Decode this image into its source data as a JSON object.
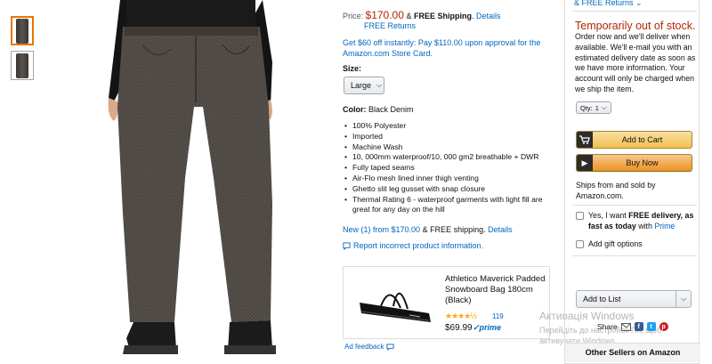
{
  "gallery": {
    "thumb_count": 2,
    "active_index": 0
  },
  "pricing": {
    "price_label": "Price:",
    "price": "$170.00",
    "amp": "&",
    "free_shipping": "FREE Shipping",
    "details": "Details",
    "free_returns": "FREE Returns"
  },
  "promo": "Get $60 off instantly: Pay $110.00 upon approval for the Amazon.com Store Card.",
  "size": {
    "label": "Size:",
    "value": "Large"
  },
  "color": {
    "label": "Color:",
    "value": "Black Denim"
  },
  "bullets": [
    "100% Polyester",
    "Imported",
    "Machine Wash",
    "10, 000mm waterproof/10, 000 gm2 breathable + DWR",
    "Fully taped seams",
    "Air-Flo mesh lined inner thigh venting",
    "Ghetto slit leg gusset with snap closure",
    "Thermal Rating 6 - waterproof garments with light fill are great for any day on the hill"
  ],
  "offers": {
    "new_link": "New (1) from $170.00",
    "amp": "&",
    "shipping": "FREE shipping.",
    "details": "Details"
  },
  "report": "Report incorrect product information.",
  "ad": {
    "title": "Athletico Maverick Padded Snowboard Bag 180cm (Black)",
    "stars": "★★★★½",
    "rating_count": "119",
    "price": "$69.99",
    "prime": "✓prime",
    "feedback": "Ad feedback"
  },
  "buybox": {
    "returns": "& FREE Returns",
    "stock": "Temporarily out of stock.",
    "stock_text": "Order now and we'll deliver when available. We'll e-mail you with an estimated delivery date as soon as we have more information. Your account will only be charged when we ship the item.",
    "qty_label": "Qty:",
    "qty_value": "1",
    "add_to_cart": "Add to Cart",
    "buy_now": "Buy Now",
    "ships": "Ships from and sold by Amazon.com.",
    "free_delivery_pre": "Yes, I want ",
    "free_delivery_bold": "FREE delivery, as fast as today",
    "free_delivery_mid": " with ",
    "free_delivery_link": "Prime",
    "gift": "Add gift options",
    "add_to_list": "Add to List",
    "share": "Share",
    "other_sellers": "Other Sellers on Amazon"
  },
  "watermark": {
    "line1": "Активація Windows",
    "line2": "Перейдіть до настройок ПК, щоб активувати Windows."
  },
  "colors": {
    "price": "#b12704",
    "link": "#0066c0",
    "cart": "#f0c14b",
    "buy": "#ed9220"
  }
}
